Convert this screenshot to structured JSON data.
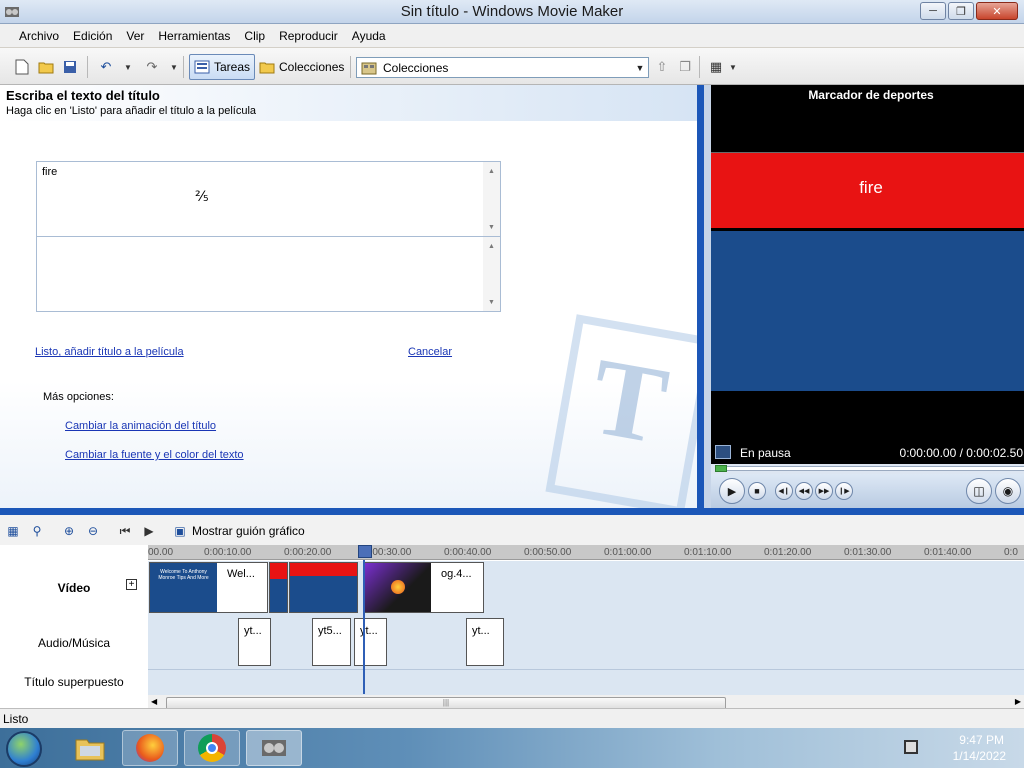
{
  "window": {
    "title": "Sin título - Windows Movie Maker"
  },
  "menu": [
    "Archivo",
    "Edición",
    "Ver",
    "Herramientas",
    "Clip",
    "Reproducir",
    "Ayuda"
  ],
  "toolbar": {
    "tasks_label": "Tareas",
    "collections_label": "Colecciones",
    "combo_value": "Colecciones"
  },
  "title_pane": {
    "heading": "Escriba el texto del título",
    "subheading": "Haga clic en 'Listo' para añadir el título a la película",
    "text_value": "fire",
    "done_link": "Listo, añadir título a la película",
    "cancel_link": "Cancelar",
    "more_options": "Más opciones:",
    "change_animation_link": "Cambiar la animación del título",
    "change_font_link": "Cambiar la fuente y el color del texto"
  },
  "monitor": {
    "title": "Marcador de deportes",
    "preview_text": "fire",
    "status": "En pausa",
    "time": "0:00:00.00 / 0:00:02.50",
    "progress": 0.0
  },
  "timeline": {
    "storyboard_label": "Mostrar guión gráfico",
    "ticks": [
      "00.00",
      "0:00:10.00",
      "0:00:20.00",
      "0:00:30.00",
      "0:00:40.00",
      "0:00:50.00",
      "0:01:00.00",
      "0:01:10.00",
      "0:01:20.00",
      "0:01:30.00",
      "0:01:40.00",
      "0:0"
    ],
    "tracks": {
      "video": "Vídeo",
      "audio": "Audio/Música",
      "title": "Título superpuesto"
    },
    "video_clips": [
      {
        "thumb_text": "Welcome To Anthony Monroe Tips And More",
        "label": "Wel..."
      },
      {
        "label": ""
      },
      {
        "label": "og.4..."
      }
    ],
    "audio_clips": [
      "yt...",
      "yt5...",
      "yt...",
      "yt..."
    ]
  },
  "statusbar": {
    "text": "Listo"
  },
  "taskbar": {
    "apps": [
      "explorer",
      "firefox",
      "chrome",
      "movie-maker"
    ],
    "time": "9:47 PM",
    "date": "1/14/2022"
  },
  "colors": {
    "accent": "#1c57b8",
    "preview_red": "#e81313",
    "preview_blue": "#1b4c8c",
    "link": "#1a36b5"
  }
}
